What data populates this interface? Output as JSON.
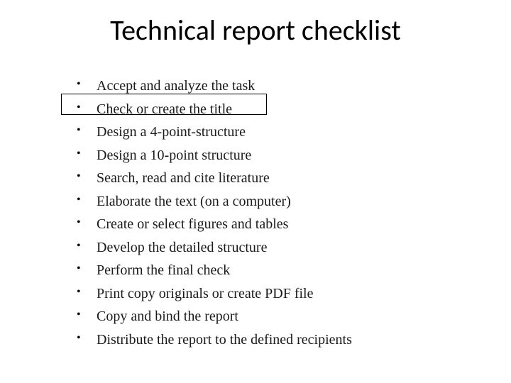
{
  "slide": {
    "title": "Technical report checklist",
    "items": [
      "Accept and analyze the task",
      "Check or create the title",
      "Design a 4-point-structure",
      "Design a 10-point structure",
      "Search, read and cite literature",
      "Elaborate the text (on a computer)",
      "Create or select figures and tables",
      "Develop the detailed structure",
      "Perform the final check",
      "Print copy originals or create PDF file",
      "Copy and bind the report",
      "Distribute the report to the defined recipients"
    ],
    "highlighted_index": 1
  }
}
